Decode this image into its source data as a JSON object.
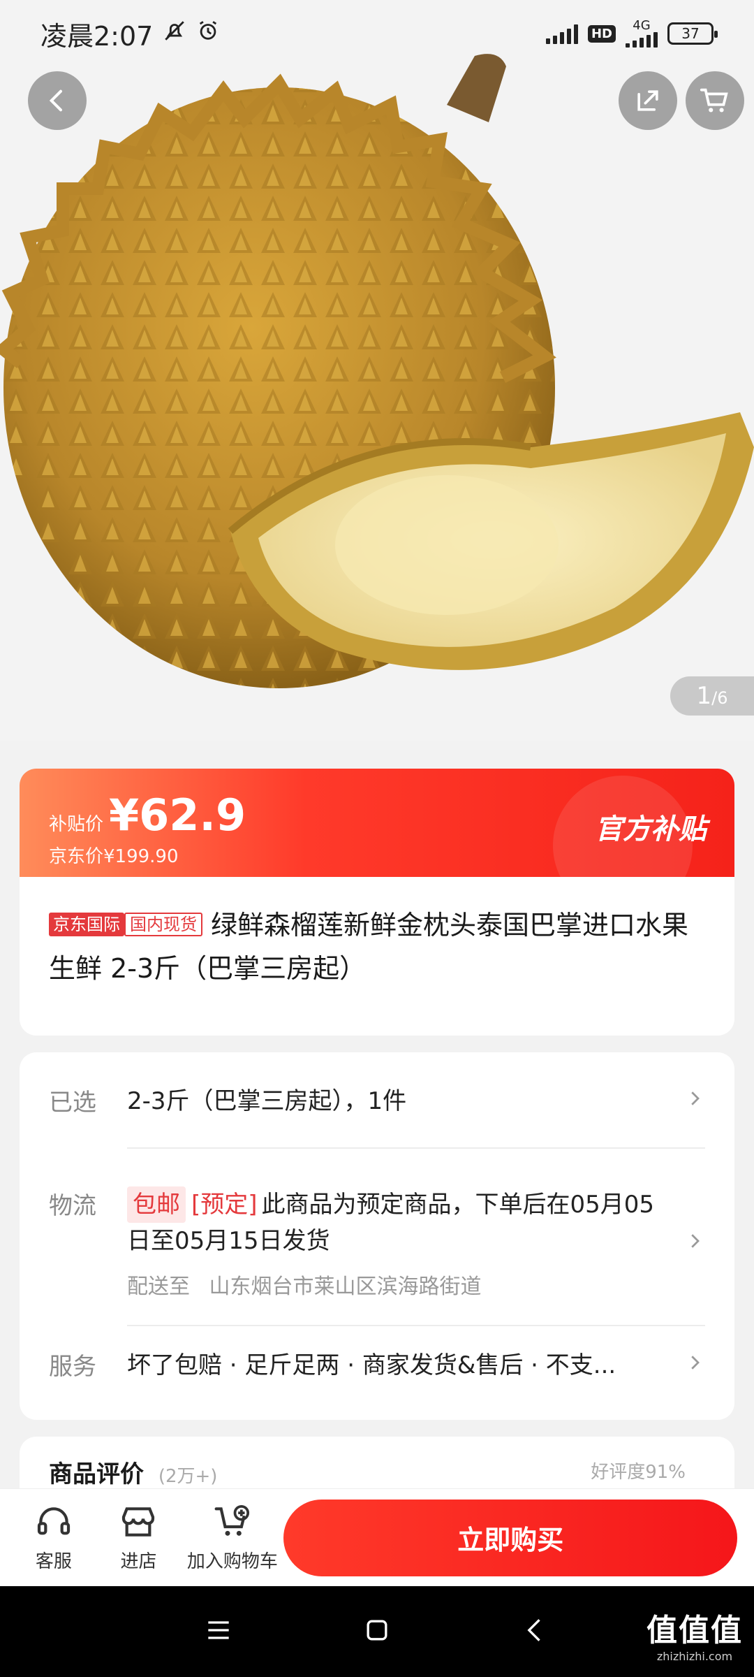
{
  "status_bar": {
    "time": "凌晨2:07",
    "network": "4G",
    "hd": "HD",
    "battery": "37"
  },
  "gallery": {
    "page_current": "1",
    "page_total": "/6"
  },
  "price": {
    "subsidy_label": "补贴价",
    "subsidy_price": "¥62.9",
    "jd_price": "京东价¥199.90",
    "official_badge": "官方补贴"
  },
  "product": {
    "tag_international": "京东国际",
    "tag_stock": "国内现货",
    "title": "绿鲜森榴莲新鲜金枕头泰国巴掌进口水果生鲜 2-3斤（巴掌三房起）"
  },
  "selection": {
    "label": "已选",
    "value": "2-3斤（巴掌三房起），1件"
  },
  "logistics": {
    "label": "物流",
    "free_shipping": "包邮",
    "presale": "[预定]",
    "note": "此商品为预定商品，下单后在05月05日至05月15日发货",
    "deliver_to_label": "配送至",
    "address": "山东烟台市莱山区滨海路街道"
  },
  "service": {
    "label": "服务",
    "value": "坏了包赔 · 足斤足两 · 商家发货&售后 · 不支..."
  },
  "reviews": {
    "title": "商品评价",
    "count": "(2万+)",
    "rate": "好评度91%"
  },
  "actions": {
    "service": "客服",
    "store": "进店",
    "add_cart": "加入购物车",
    "buy": "立即购买"
  },
  "watermark": {
    "main": "值值值",
    "sub": "zhizhizhi.com"
  },
  "colors": {
    "accent": "#f5221a",
    "price_gradient_start": "#ff8c5a",
    "tag_red": "#e4393c"
  }
}
